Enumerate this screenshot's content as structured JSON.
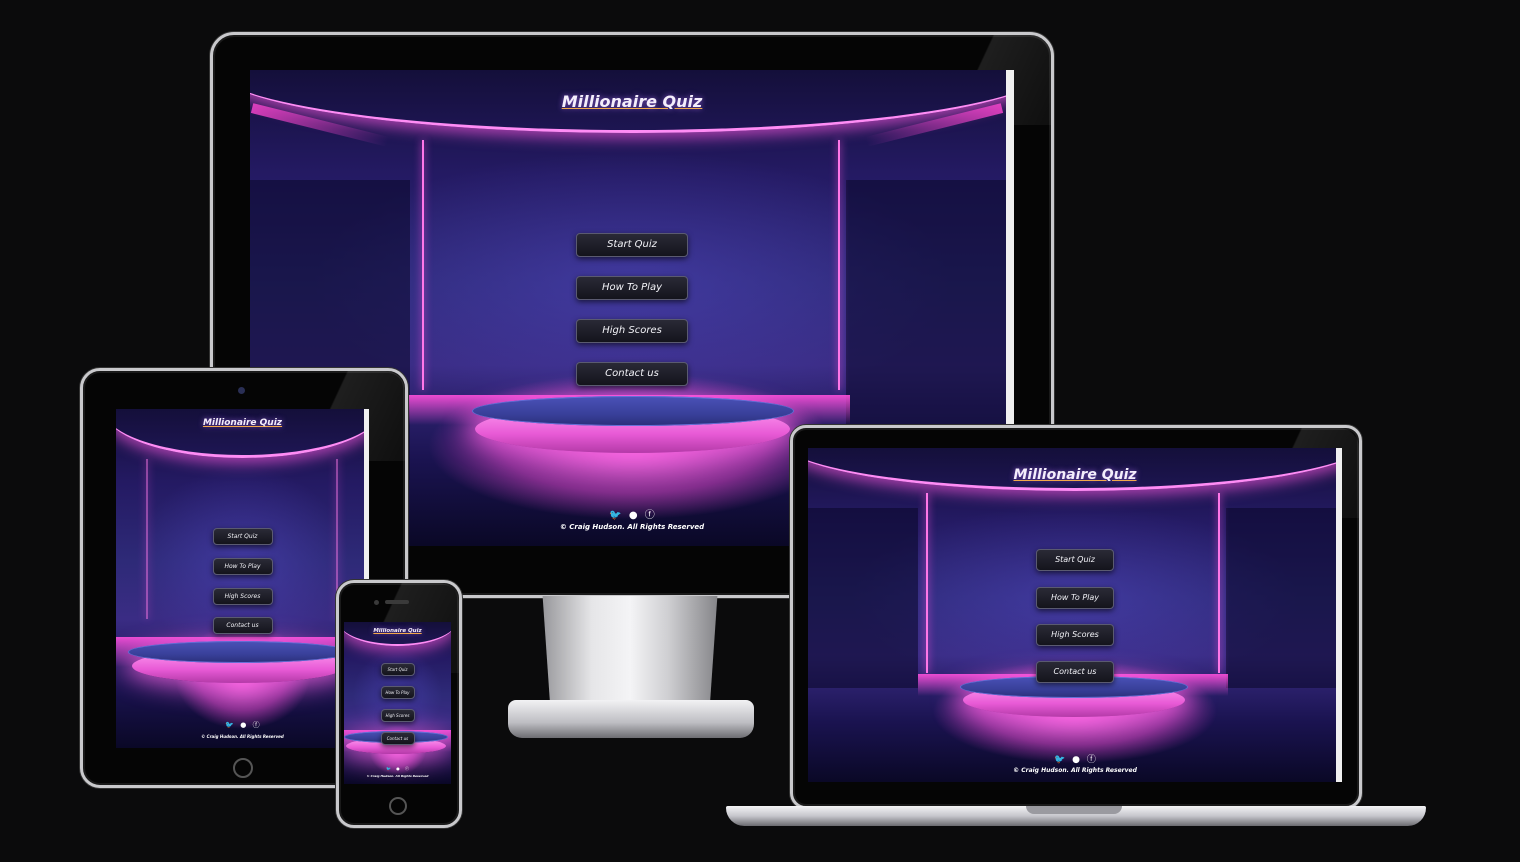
{
  "site": {
    "title": "Millionaire Quiz",
    "menu": [
      "Start Quiz",
      "How To Play",
      "High Scores",
      "Contact us"
    ],
    "social_icons": [
      "twitter-icon",
      "github-icon",
      "facebook-icon"
    ],
    "copyright": "© Craig Hudson. All Rights Reserved"
  },
  "colors": {
    "background": "#0b0b0c",
    "neon_pink": "#ff77e8",
    "title_underline": "#f1a84a",
    "button_bg": "#1c1c26"
  }
}
